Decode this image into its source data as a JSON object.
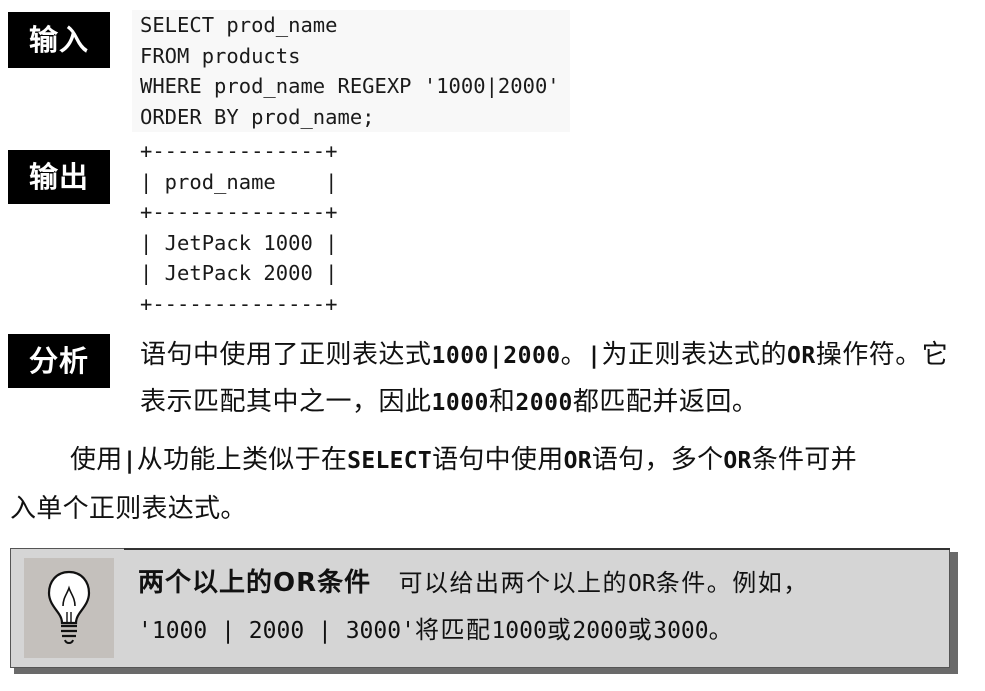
{
  "labels": {
    "input": "输入",
    "output": "输出",
    "analysis": "分析"
  },
  "code_lines": [
    "SELECT prod_name",
    "FROM products",
    "WHERE prod_name REGEXP '1000|2000'",
    "ORDER BY prod_name;"
  ],
  "output_lines": [
    "+--------------+",
    "| prod_name    |",
    "+--------------+",
    "| JetPack 1000 |",
    "| JetPack 2000 |",
    "+--------------+"
  ],
  "analysis": {
    "t1": "语句中使用了正则表达式",
    "m1": "1000|2000",
    "t2": "。",
    "m2": "|",
    "t3": "为正则表达式的",
    "m3": "OR",
    "t4": "操作符。它表示匹配其中之一，因此",
    "m4": "1000",
    "t5": "和",
    "m5": "2000",
    "t6": "都匹配并返回。"
  },
  "paragraph": {
    "t1": "使用",
    "m1": "|",
    "t2": "从功能上类似于在",
    "m2": "SELECT",
    "t3": "语句中使用",
    "m3": "OR",
    "t4": "语句，多个",
    "m4": "OR",
    "t5": "条件可并",
    "line2": "入单个正则表达式。"
  },
  "tip": {
    "title_a": "两个以上的",
    "title_m": "OR",
    "title_b": "条件",
    "t1": "可以给出两个以上的",
    "m1": "OR",
    "t2": "条件。例如，",
    "m2": "'1000 | 2000 | 3000'",
    "t3": "将匹配",
    "m3": "1000",
    "t4": "或",
    "m4": "2000",
    "t5": "或",
    "m5": "3000",
    "t6": "。",
    "icon": "lightbulb-icon"
  }
}
